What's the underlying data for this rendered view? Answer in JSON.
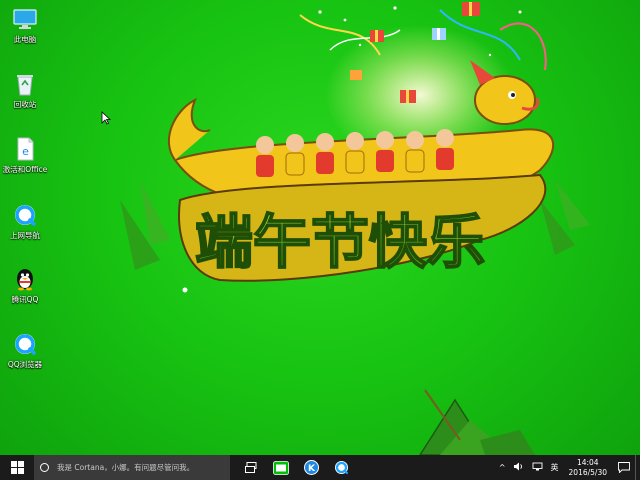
{
  "desktop_icons": [
    {
      "label": "此电脑",
      "icon": "computer-icon"
    },
    {
      "label": "回收站",
      "icon": "recycle-bin-icon"
    },
    {
      "label": "激活和Office",
      "icon": "document-icon"
    },
    {
      "label": "上网导航",
      "icon": "browser-icon"
    },
    {
      "label": "腾讯QQ",
      "icon": "qq-penguin-icon"
    },
    {
      "label": "QQ浏览器",
      "icon": "qq-browser-icon"
    }
  ],
  "wallpaper": {
    "title_glyphs": "端午节快乐"
  },
  "taskbar": {
    "search_placeholder": "我是 Cortana，小娜。有问题尽管问我。",
    "pinned": [
      "task-view-icon",
      "iqiyi-icon",
      "k-app-icon",
      "qq-browser-icon"
    ],
    "tray_chevron": "^",
    "ime_label": "英",
    "time": "14:04",
    "date": "2016/5/30"
  },
  "colors": {
    "desktop_green": "#18c412",
    "taskbar": "#1b1b1b",
    "search_box": "#3a3a3a"
  }
}
